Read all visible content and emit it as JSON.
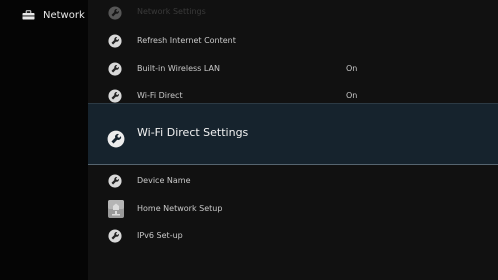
{
  "sidebar": {
    "category_label": "Network",
    "category_icon": "toolbox-icon"
  },
  "list": {
    "items": [
      {
        "label": "Network Settings",
        "value": "",
        "icon": "wrench-icon"
      },
      {
        "label": "Refresh Internet Content",
        "value": "",
        "icon": "wrench-icon"
      },
      {
        "label": "Built-in Wireless LAN",
        "value": "On",
        "icon": "wrench-icon"
      },
      {
        "label": "Wi-Fi Direct",
        "value": "On",
        "icon": "wrench-icon"
      },
      {
        "label": "Wi-Fi Direct Settings",
        "value": "",
        "icon": "wrench-icon",
        "selected": true
      },
      {
        "label": "Device Name",
        "value": "",
        "icon": "wrench-icon"
      },
      {
        "label": "Home Network Setup",
        "value": "",
        "icon": "home-network-icon"
      },
      {
        "label": "IPv6 Set-up",
        "value": "",
        "icon": "wrench-icon"
      }
    ]
  },
  "colors": {
    "background": "#111111",
    "selected_row": "#16232d",
    "text": "#c9c9c9",
    "selected_text": "#f2f2f2"
  }
}
